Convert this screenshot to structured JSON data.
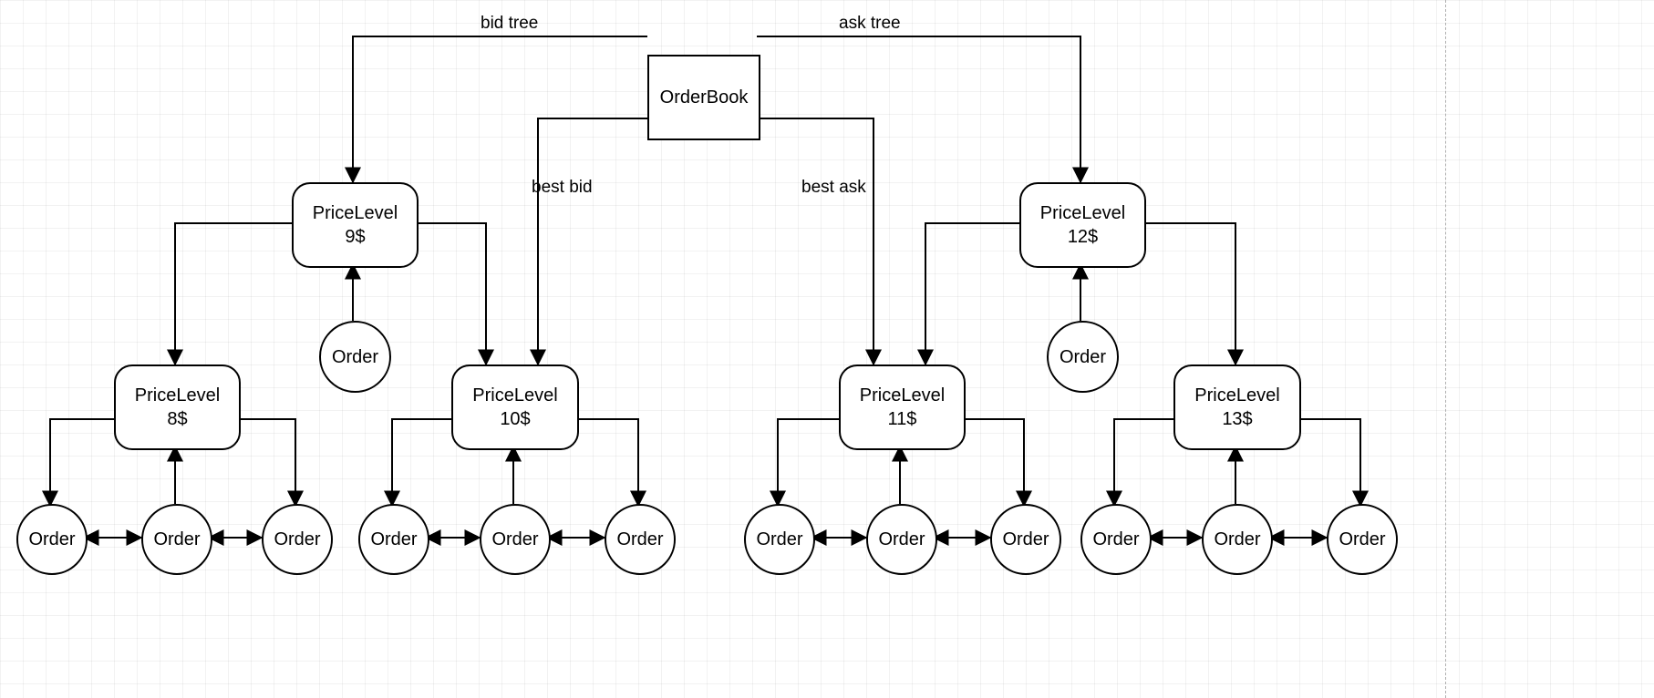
{
  "root": {
    "label": "OrderBook"
  },
  "edge_labels": {
    "bid_tree": "bid tree",
    "ask_tree": "ask tree",
    "best_bid": "best bid",
    "best_ask": "best ask"
  },
  "price_levels": {
    "pl9": {
      "title": "PriceLevel",
      "price": "9$"
    },
    "pl12": {
      "title": "PriceLevel",
      "price": "12$"
    },
    "pl8": {
      "title": "PriceLevel",
      "price": "8$"
    },
    "pl10": {
      "title": "PriceLevel",
      "price": "10$"
    },
    "pl11": {
      "title": "PriceLevel",
      "price": "11$"
    },
    "pl13": {
      "title": "PriceLevel",
      "price": "13$"
    }
  },
  "order_label": "Order"
}
